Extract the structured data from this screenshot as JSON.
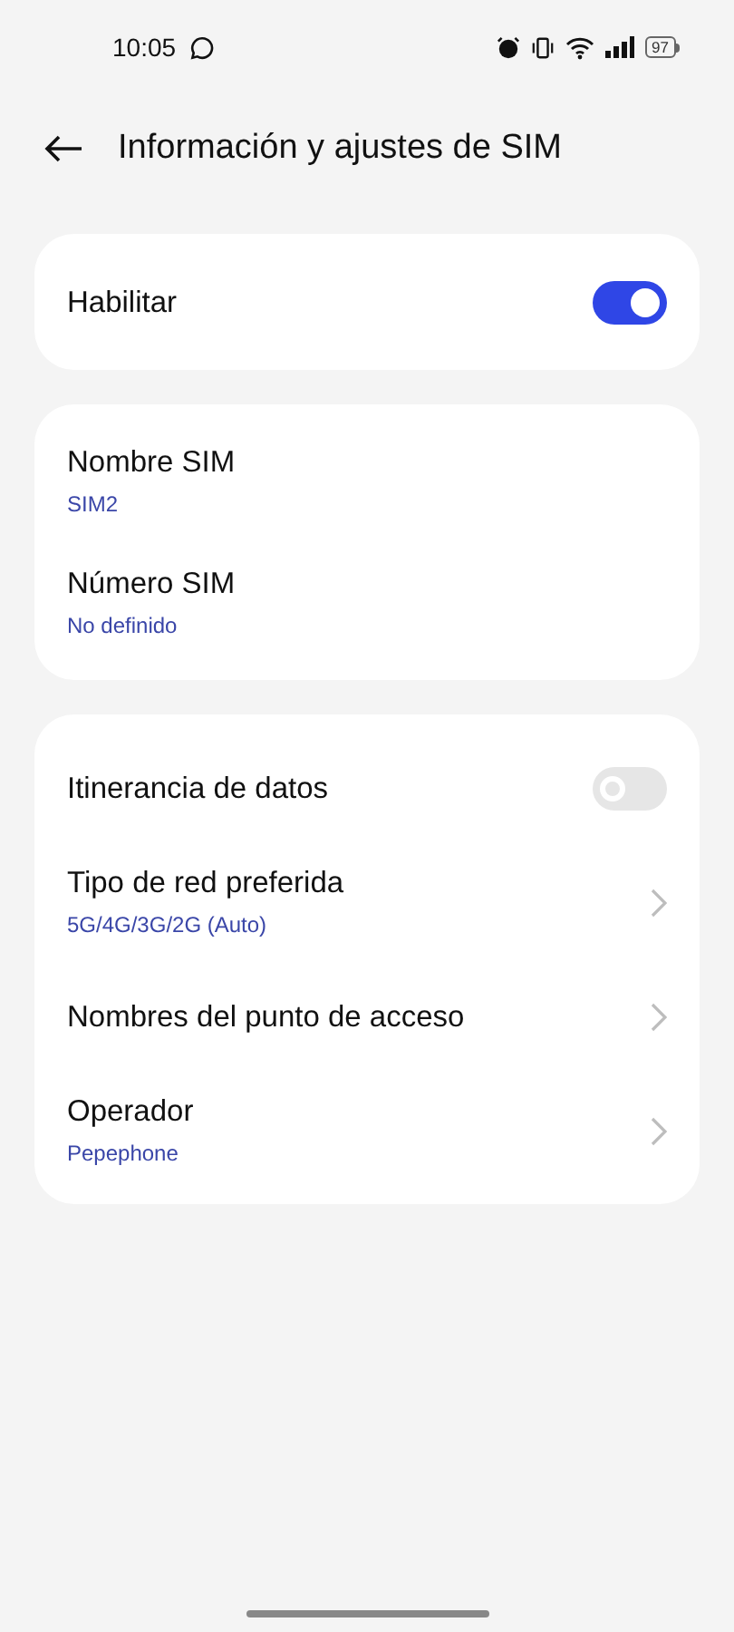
{
  "status_bar": {
    "time": "10:05",
    "battery": "97"
  },
  "header": {
    "title": "Información y ajustes de SIM"
  },
  "cards": [
    {
      "rows": [
        {
          "kind": "toggle",
          "label": "Habilitar",
          "on": true
        }
      ]
    },
    {
      "rows": [
        {
          "kind": "info",
          "label": "Nombre SIM",
          "value": "SIM2"
        },
        {
          "kind": "info",
          "label": "Número SIM",
          "value": "No definido"
        }
      ]
    },
    {
      "rows": [
        {
          "kind": "toggle",
          "label": "Itinerancia de datos",
          "on": false
        },
        {
          "kind": "link",
          "label": "Tipo de red preferida",
          "value": "5G/4G/3G/2G (Auto)"
        },
        {
          "kind": "link",
          "label": "Nombres del punto de acceso"
        },
        {
          "kind": "link",
          "label": "Operador",
          "value": "Pepephone"
        }
      ]
    }
  ]
}
